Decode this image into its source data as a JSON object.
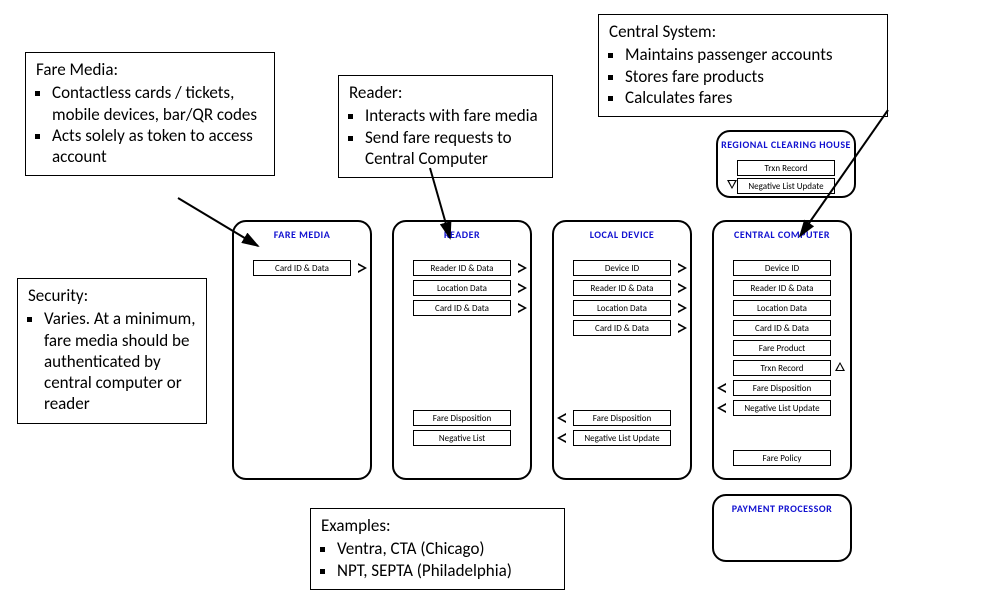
{
  "callouts": {
    "fareMedia": {
      "title": "Fare Media:",
      "items": [
        "Contactless cards / tickets, mobile devices, bar/QR codes",
        "Acts solely as token to access account"
      ]
    },
    "reader": {
      "title": "Reader:",
      "items": [
        "Interacts with fare media",
        "Send fare requests to Central Computer"
      ]
    },
    "central": {
      "title": "Central System:",
      "items": [
        "Maintains passenger accounts",
        "Stores fare products",
        "Calculates fares"
      ]
    },
    "security": {
      "title": "Security:",
      "items": [
        "Varies.  At a minimum, fare media should be authenticated by central computer or reader"
      ]
    },
    "examples": {
      "title": "Examples:",
      "items": [
        "Ventra, CTA (Chicago)",
        "NPT, SEPTA (Philadelphia)"
      ]
    }
  },
  "modules": {
    "clearingHouse": {
      "title": "REGIONAL CLEARING HOUSE",
      "slots": [
        "Trxn Record",
        "Negative List Update"
      ]
    },
    "fareMedia": {
      "title": "FARE MEDIA",
      "slots": [
        "Card ID & Data"
      ]
    },
    "reader": {
      "title": "READER",
      "top": [
        "Reader ID & Data",
        "Location Data",
        "Card ID & Data"
      ],
      "bottom": [
        "Fare Disposition",
        "Negative List"
      ]
    },
    "localDevice": {
      "title": "LOCAL DEVICE",
      "top": [
        "Device ID",
        "Reader ID & Data",
        "Location Data",
        "Card ID & Data"
      ],
      "bottom": [
        "Fare Disposition",
        "Negative List Update"
      ]
    },
    "centralComputer": {
      "title": "CENTRAL COMPUTER",
      "top": [
        "Device ID",
        "Reader ID & Data",
        "Location Data",
        "Card ID & Data",
        "Fare Product",
        "Trxn Record",
        "Fare Disposition",
        "Negative List Update"
      ],
      "bottom": [
        "Fare Policy"
      ]
    },
    "paymentProcessor": {
      "title": "PAYMENT PROCESSOR"
    }
  }
}
